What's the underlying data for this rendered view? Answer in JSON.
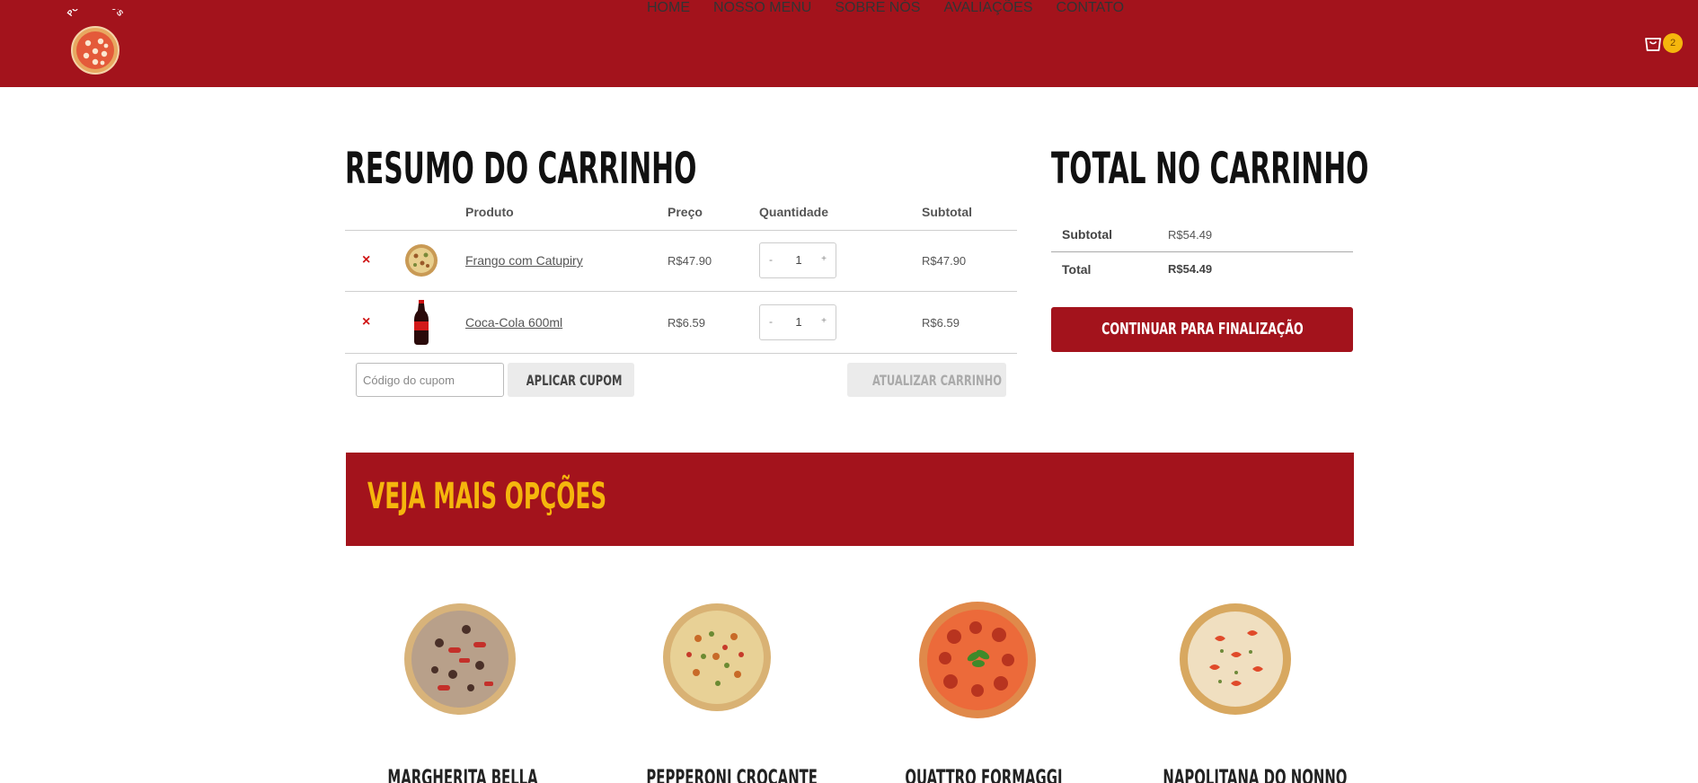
{
  "header": {
    "logo_text": "POLLINARIO'S",
    "nav": [
      "HOME",
      "NOSSO MENU",
      "SOBRE NÓS",
      "AVALIAÇÕES",
      "CONTATO"
    ],
    "cart_count": "2",
    "colors": {
      "brand_red": "#a3131c",
      "accent_yellow": "#f5b60d"
    }
  },
  "cart": {
    "title": "RESUMO DO CARRINHO",
    "columns": {
      "product": "Produto",
      "price": "Preço",
      "quantity": "Quantidade",
      "subtotal": "Subtotal"
    },
    "items": [
      {
        "remove": "×",
        "name": "Frango com Catupiry",
        "price": "R$47.90",
        "qty_minus": "-",
        "qty": "1",
        "qty_plus": "+",
        "subtotal": "R$47.90",
        "thumb_icon": "pizza-thumbnail"
      },
      {
        "remove": "×",
        "name": "Coca-Cola 600ml",
        "price": "R$6.59",
        "qty_minus": "-",
        "qty": "1",
        "qty_plus": "+",
        "subtotal": "R$6.59",
        "thumb_icon": "soda-bottle-thumbnail"
      }
    ],
    "coupon_placeholder": "Código do cupom",
    "apply_coupon": "APLICAR CUPOM",
    "update_cart": "ATUALIZAR CARRINHO"
  },
  "totals": {
    "title": "TOTAL NO CARRINHO",
    "subtotal_label": "Subtotal",
    "subtotal_value": "R$54.49",
    "total_label": "Total",
    "total_value": "R$54.49",
    "checkout": "CONTINUAR PARA FINALIZAÇÃO"
  },
  "more": {
    "title": "VEJA MAIS OPÇÕES",
    "products": [
      {
        "name": "MARGHERITA BELLA"
      },
      {
        "name": "PEPPERONI CROCANTE"
      },
      {
        "name": "QUATTRO FORMAGGI"
      },
      {
        "name": "NAPOLITANA DO NONNO"
      }
    ]
  }
}
